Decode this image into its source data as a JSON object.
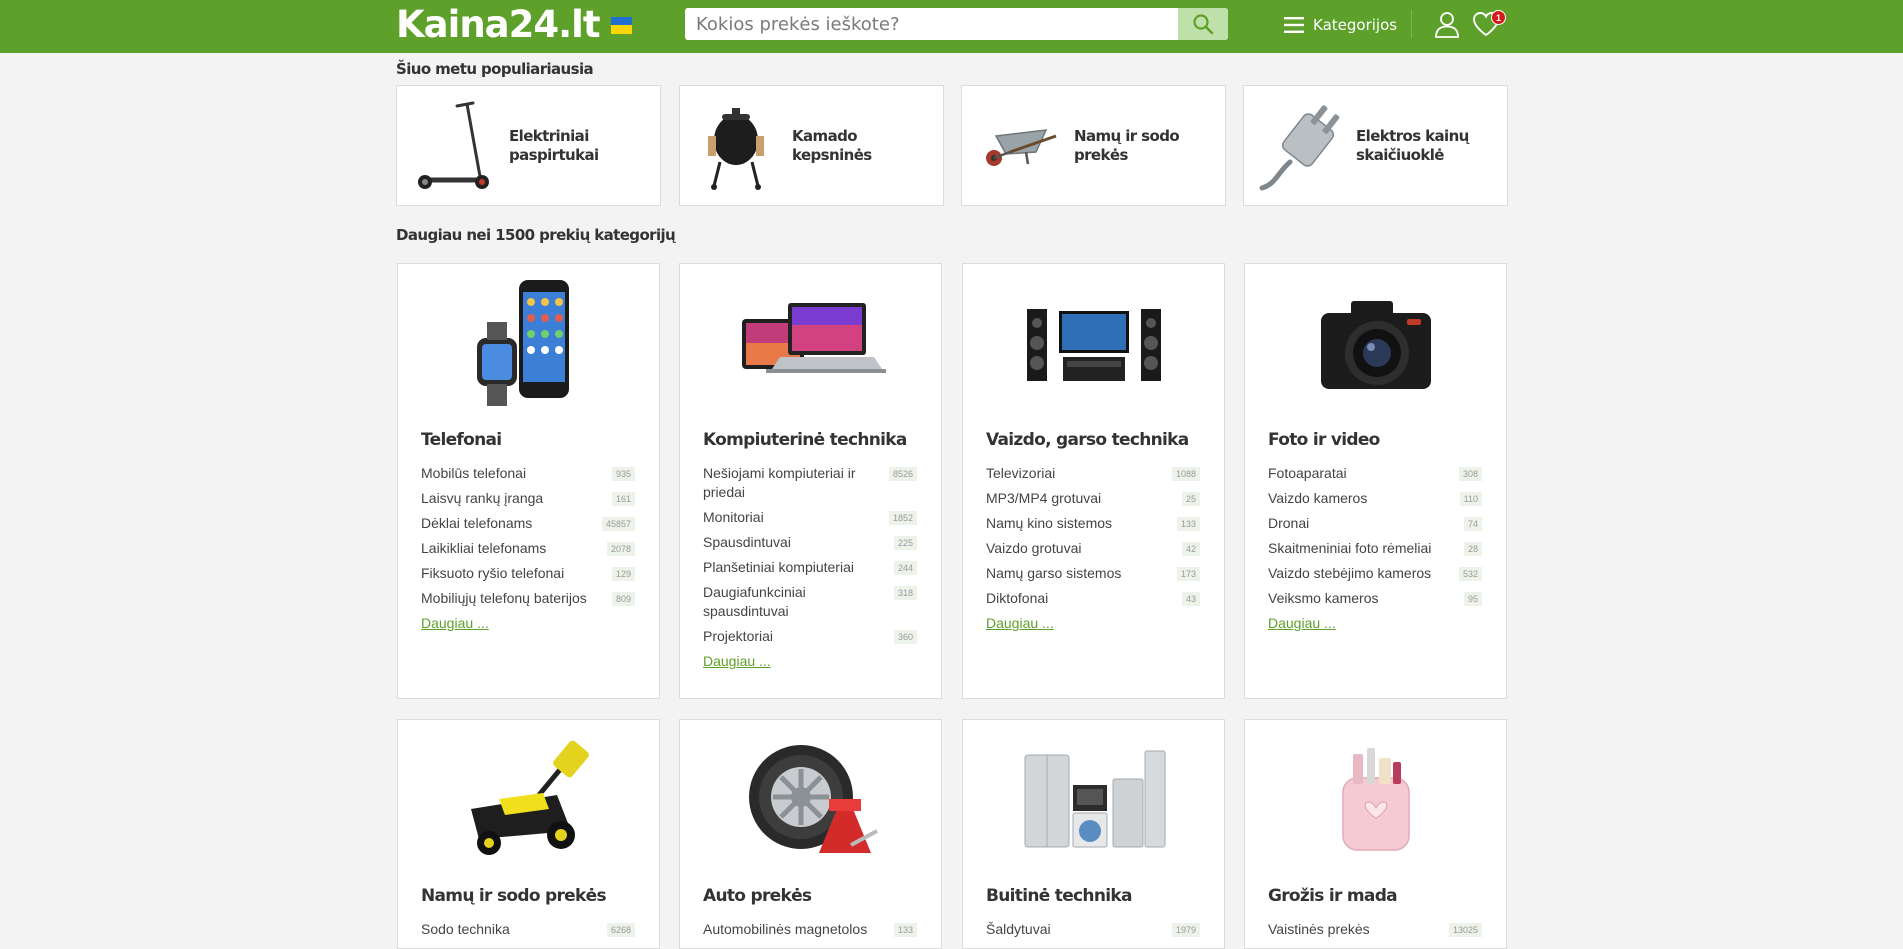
{
  "header": {
    "logo": "Kaina24.lt",
    "search_placeholder": "Kokios prekės ieškote?",
    "menu_label": "Kategorijos",
    "wishlist_count": "1"
  },
  "popular": {
    "title": "Šiuo metu populiariausia",
    "items": [
      {
        "label": "Elektriniai paspirtukai",
        "icon": "scooter-image"
      },
      {
        "label": "Kamado kepsninės",
        "icon": "kamado-grill-image"
      },
      {
        "label": "Namų ir sodo prekės",
        "icon": "wheelbarrow-image"
      },
      {
        "label": "Elektros kainų skaičiuoklė",
        "icon": "power-plug-image"
      }
    ]
  },
  "categories": {
    "title": "Daugiau nei 1500 prekių kategorijų",
    "more_label": "Daugiau ...",
    "cards": [
      {
        "title": "Telefonai",
        "image": "phone-watch-image",
        "items": [
          {
            "label": "Mobilūs telefonai",
            "count": "935"
          },
          {
            "label": "Laisvų rankų įranga",
            "count": "161"
          },
          {
            "label": "Dėklai telefonams",
            "count": "45857"
          },
          {
            "label": "Laikikliai telefonams",
            "count": "2078"
          },
          {
            "label": "Fiksuoto ryšio telefonai",
            "count": "129"
          },
          {
            "label": "Mobiliųjų telefonų baterijos",
            "count": "809"
          }
        ]
      },
      {
        "title": "Kompiuterinė technika",
        "image": "laptop-tablet-image",
        "items": [
          {
            "label": "Nešiojami kompiuteriai ir priedai",
            "count": "8526"
          },
          {
            "label": "Monitoriai",
            "count": "1852"
          },
          {
            "label": "Spausdintuvai",
            "count": "225"
          },
          {
            "label": "Planšetiniai kompiuteriai",
            "count": "244"
          },
          {
            "label": "Daugiafunkciniai spausdintuvai",
            "count": "318"
          },
          {
            "label": "Projektoriai",
            "count": "360"
          }
        ]
      },
      {
        "title": "Vaizdo, garso technika",
        "image": "tv-speakers-image",
        "items": [
          {
            "label": "Televizoriai",
            "count": "1088"
          },
          {
            "label": "MP3/MP4 grotuvai",
            "count": "25"
          },
          {
            "label": "Namų kino sistemos",
            "count": "133"
          },
          {
            "label": "Vaizdo grotuvai",
            "count": "42"
          },
          {
            "label": "Namų garso sistemos",
            "count": "173"
          },
          {
            "label": "Diktofonai",
            "count": "43"
          }
        ]
      },
      {
        "title": "Foto ir video",
        "image": "camera-image",
        "items": [
          {
            "label": "Fotoaparatai",
            "count": "308"
          },
          {
            "label": "Vaizdo kameros",
            "count": "110"
          },
          {
            "label": "Dronai",
            "count": "74"
          },
          {
            "label": "Skaitmeniniai foto rėmeliai",
            "count": "28"
          },
          {
            "label": "Vaizdo stebėjimo kameros",
            "count": "532"
          },
          {
            "label": "Veiksmo kameros",
            "count": "95"
          }
        ]
      },
      {
        "title": "Namų ir sodo prekės",
        "image": "lawnmower-image",
        "items": [
          {
            "label": "Sodo technika",
            "count": "6268"
          }
        ]
      },
      {
        "title": "Auto prekės",
        "image": "tire-jack-image",
        "items": [
          {
            "label": "Automobilinės magnetolos",
            "count": "133"
          }
        ]
      },
      {
        "title": "Buitinė technika",
        "image": "appliances-image",
        "items": [
          {
            "label": "Šaldytuvai",
            "count": "1979"
          }
        ]
      },
      {
        "title": "Grožis ir mada",
        "image": "cosmetic-bag-image",
        "items": [
          {
            "label": "Vaistinės prekės",
            "count": "13025"
          }
        ]
      }
    ]
  },
  "colors": {
    "brand_green": "#5da02a",
    "link_green": "#5da02a",
    "badge_red": "#d41a1a"
  }
}
